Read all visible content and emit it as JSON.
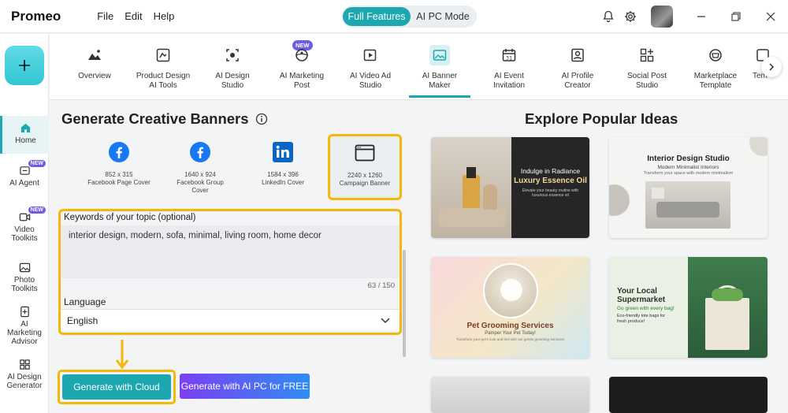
{
  "app": {
    "title": "Promeo",
    "menus": [
      "File",
      "Edit",
      "Help"
    ],
    "modes": {
      "active": "Full Features",
      "inactive": "AI PC Mode"
    },
    "icons": [
      "bell-icon",
      "gear-icon",
      "avatar",
      "minimize-icon",
      "restore-icon",
      "close-icon"
    ]
  },
  "sidebar": {
    "add_icon": "plus-icon",
    "items": [
      {
        "label": "Home",
        "icon": "home-icon",
        "active": true
      },
      {
        "label": "AI Agent",
        "icon": "ai-agent-icon",
        "badge": "NEW"
      },
      {
        "label": "Video Toolkits",
        "icon": "video-icon",
        "badge": "NEW"
      },
      {
        "label": "Photo Toolkits",
        "icon": "photo-icon"
      },
      {
        "label": "AI Marketing Advisor",
        "icon": "advisor-icon"
      },
      {
        "label": "AI Design Generator",
        "icon": "grid-icon"
      }
    ]
  },
  "tools": {
    "new_badge": "NEW",
    "items": [
      {
        "label": "Overview"
      },
      {
        "label": "Product Design AI Tools"
      },
      {
        "label": "AI Design Studio"
      },
      {
        "label": "AI Marketing Post"
      },
      {
        "label": "AI Video Ad Studio"
      },
      {
        "label": "AI Banner Maker",
        "active": true
      },
      {
        "label": "AI Event Invitation"
      },
      {
        "label": "AI Profile Creator"
      },
      {
        "label": "Social Post Studio"
      },
      {
        "label": "Marketplace Template"
      },
      {
        "label": "Tem"
      }
    ]
  },
  "generator": {
    "title": "Generate Creative Banners",
    "sizes": [
      {
        "dims": "852 x 315",
        "name": "Facebook Page Cover",
        "icon": "facebook-icon"
      },
      {
        "dims": "1640 x 924",
        "name": "Facebook Group Cover",
        "icon": "facebook-icon"
      },
      {
        "dims": "1584 x 396",
        "name": "LinkedIn Cover",
        "icon": "linkedin-icon"
      },
      {
        "dims": "2240 x 1260",
        "name": "Campaign Banner",
        "icon": "browser-window-icon",
        "selected": true
      }
    ],
    "keywords_label": "Keywords of your topic (optional)",
    "keywords_value": "interior design, modern, sofa, minimal, living room, home decor",
    "keywords_count": "63 / 150",
    "language_label": "Language",
    "language_value": "English",
    "generate_cloud": "Generate with Cloud",
    "generate_aipc": "Generate with AI PC for FREE"
  },
  "explore": {
    "title": "Explore Popular Ideas",
    "cards": [
      {
        "headline": "Indulge in Radiance",
        "title": "Luxury Essence Oil",
        "sub": "Elevate your beauty routine with luxurious essence oil"
      },
      {
        "headline": "Interior Design Studio",
        "title": "Modern Minimalist Interiors",
        "sub": "Transform your space with modern minimalism"
      },
      {
        "headline": "Pet Grooming Services",
        "title": "Pamper Your Pet Today!",
        "sub": "Transform your pet's look and feel with our gentle grooming services!"
      },
      {
        "headline": "Your Local Supermarket",
        "title": "Go green with every bag!",
        "sub": "Eco-friendly tote bags for fresh produce!"
      }
    ]
  }
}
